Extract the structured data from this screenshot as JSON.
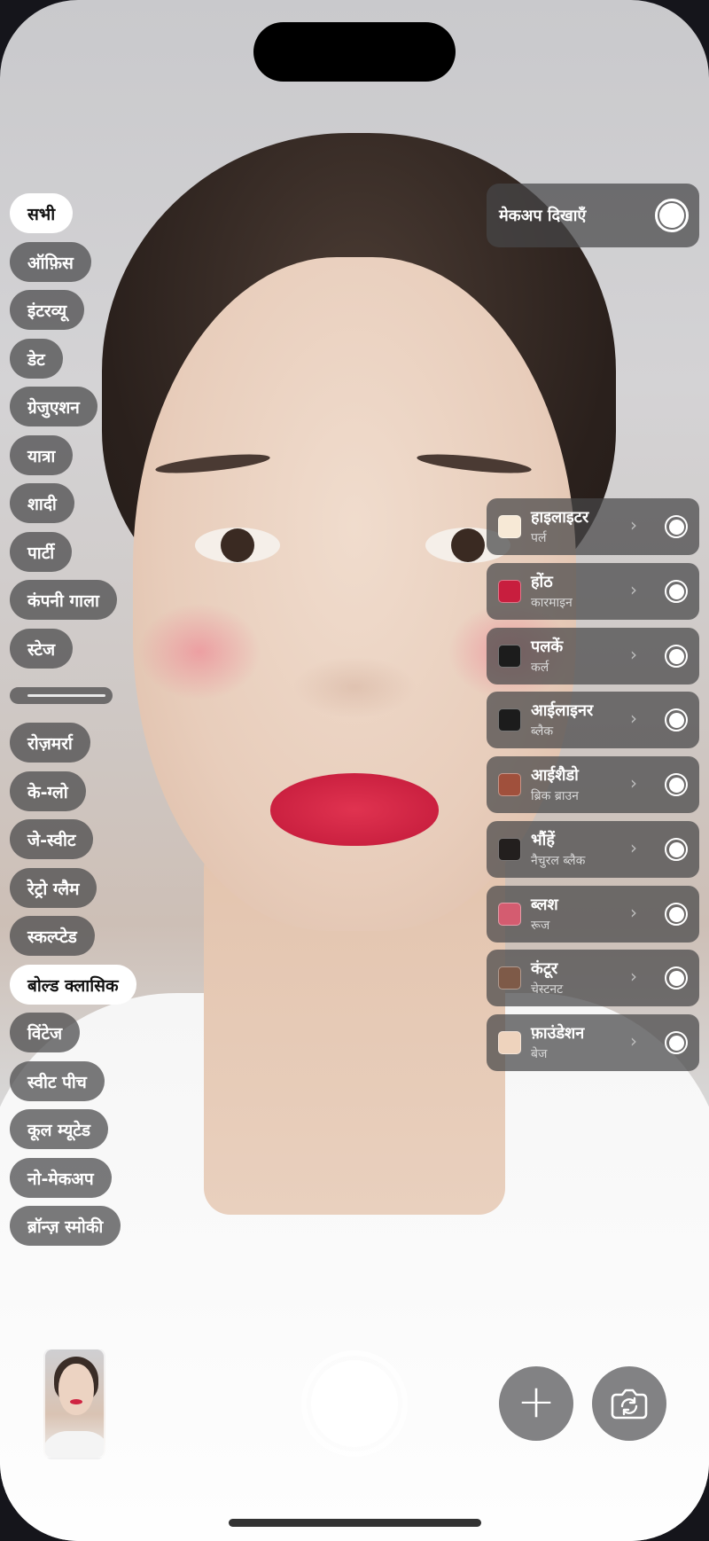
{
  "categories": {
    "items": [
      {
        "label": "सभी",
        "active": true
      },
      {
        "label": "ऑफ़िस",
        "active": false
      },
      {
        "label": "इंटरव्यू",
        "active": false
      },
      {
        "label": "डेट",
        "active": false
      },
      {
        "label": "ग्रेजुएशन",
        "active": false
      },
      {
        "label": "यात्रा",
        "active": false
      },
      {
        "label": "शादी",
        "active": false
      },
      {
        "label": "पार्टी",
        "active": false
      },
      {
        "label": "कंपनी गाला",
        "active": false
      },
      {
        "label": "स्टेज",
        "active": false
      }
    ],
    "looks": [
      {
        "label": "रोज़मर्रा",
        "active": false
      },
      {
        "label": "के-ग्लो",
        "active": false
      },
      {
        "label": "जे-स्वीट",
        "active": false
      },
      {
        "label": "रेट्रो ग्लैम",
        "active": false
      },
      {
        "label": "स्कल्प्टेड",
        "active": false
      },
      {
        "label": "बोल्ड क्लासिक",
        "active": true
      },
      {
        "label": "विंटेज",
        "active": false
      },
      {
        "label": "स्वीट पीच",
        "active": false
      },
      {
        "label": "कूल म्यूटेड",
        "active": false
      },
      {
        "label": "नो-मेकअप",
        "active": false
      },
      {
        "label": "ब्रॉन्ज़ स्मोकी",
        "active": false
      }
    ]
  },
  "makeup_toggle": {
    "label": "मेकअप दिखाएँ",
    "on": true
  },
  "products": [
    {
      "name": "हाइलाइटर",
      "shade": "पर्ल",
      "color": "#f7e9d6"
    },
    {
      "name": "होंठ",
      "shade": "कारमाइन",
      "color": "#c81e3e"
    },
    {
      "name": "पलकें",
      "shade": "कर्ल",
      "color": "#1c1c1c"
    },
    {
      "name": "आईलाइनर",
      "shade": "ब्लैक",
      "color": "#1c1c1c"
    },
    {
      "name": "आईशैडो",
      "shade": "ब्रिक ब्राउन",
      "color": "#a0503c"
    },
    {
      "name": "भौंहें",
      "shade": "नैचुरल ब्लैक",
      "color": "#231f1e"
    },
    {
      "name": "ब्लश",
      "shade": "रूज",
      "color": "#d45c70"
    },
    {
      "name": "कंटूर",
      "shade": "चेस्टनट",
      "color": "#7e5a48"
    },
    {
      "name": "फ़ाउंडेशन",
      "shade": "बेज",
      "color": "#eed3bd"
    }
  ],
  "controls": {
    "add_icon": "plus-icon",
    "flip_icon": "camera-flip-icon",
    "chevron": "›"
  }
}
